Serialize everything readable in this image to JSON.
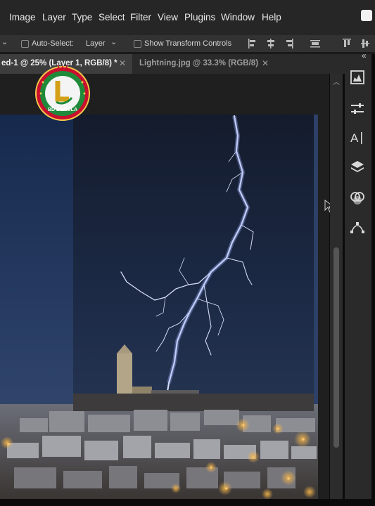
{
  "menubar": {
    "items": [
      "Image",
      "Layer",
      "Type",
      "Select",
      "Filter",
      "View",
      "Plugins",
      "Window",
      "Help"
    ]
  },
  "options": {
    "auto_select_label": "Auto-Select:",
    "auto_select_value": "Layer",
    "transform_label": "Show Transform Controls"
  },
  "tabs": [
    {
      "label": "ed-1 @ 25% (Layer 1, RGB/8) *"
    },
    {
      "label": "Lightning.jpg @ 33.3% (RGB/8)"
    }
  ],
  "logo": {
    "text": "BD BANGLA"
  },
  "dock": {
    "icons": [
      "histogram-icon",
      "adjustments-icon",
      "character-icon",
      "layers-icon",
      "channels-icon",
      "paths-icon"
    ],
    "collapse_glyph": "«"
  },
  "colors": {
    "accent": "#1f8a3a",
    "logo_red": "#c8102e",
    "canvas_sky": "#1e2c4a"
  }
}
